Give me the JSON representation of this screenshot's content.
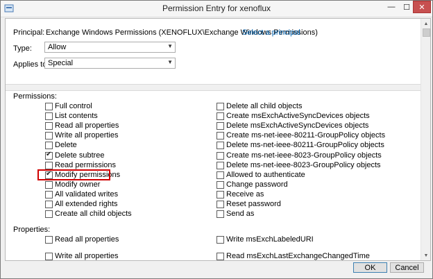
{
  "window": {
    "title": "Permission Entry for xenoflux"
  },
  "titlebar_buttons": {
    "minimize": "—",
    "maximize": "☐",
    "close": "✕"
  },
  "principal": {
    "label": "Principal:",
    "value": "Exchange Windows Permissions (XENOFLUX\\Exchange Windows Permissions)",
    "link": "Select a principal"
  },
  "type": {
    "label": "Type:",
    "value": "Allow"
  },
  "applies_to": {
    "label": "Applies to:",
    "value": "Special"
  },
  "permissions": {
    "heading": "Permissions:",
    "left": [
      {
        "label": "Full control",
        "checked": false
      },
      {
        "label": "List contents",
        "checked": false
      },
      {
        "label": "Read all properties",
        "checked": false
      },
      {
        "label": "Write all properties",
        "checked": false
      },
      {
        "label": "Delete",
        "checked": false
      },
      {
        "label": "Delete subtree",
        "checked": true
      },
      {
        "label": "Read permissions",
        "checked": false
      },
      {
        "label": "Modify permissions",
        "checked": true
      },
      {
        "label": "Modify owner",
        "checked": false
      },
      {
        "label": "All validated writes",
        "checked": false
      },
      {
        "label": "All extended rights",
        "checked": false
      },
      {
        "label": "Create all child objects",
        "checked": false
      }
    ],
    "right": [
      {
        "label": "Delete all child objects",
        "checked": false
      },
      {
        "label": "Create msExchActiveSyncDevices objects",
        "checked": false
      },
      {
        "label": "Delete msExchActiveSyncDevices objects",
        "checked": false
      },
      {
        "label": "Create ms-net-ieee-80211-GroupPolicy objects",
        "checked": false
      },
      {
        "label": "Delete ms-net-ieee-80211-GroupPolicy objects",
        "checked": false
      },
      {
        "label": "Create ms-net-ieee-8023-GroupPolicy objects",
        "checked": false
      },
      {
        "label": "Delete ms-net-ieee-8023-GroupPolicy objects",
        "checked": false
      },
      {
        "label": "Allowed to authenticate",
        "checked": false
      },
      {
        "label": "Change password",
        "checked": false
      },
      {
        "label": "Receive as",
        "checked": false
      },
      {
        "label": "Reset password",
        "checked": false
      },
      {
        "label": "Send as",
        "checked": false
      }
    ]
  },
  "properties": {
    "heading": "Properties:",
    "left": [
      {
        "label": "Read all properties",
        "checked": false
      },
      {
        "label": "Write all properties",
        "checked": false
      }
    ],
    "right": [
      {
        "label": "Write msExchLabeledURI",
        "checked": false
      },
      {
        "label": "Read msExchLastExchangeChangedTime",
        "checked": false
      }
    ]
  },
  "footer": {
    "ok": "OK",
    "cancel": "Cancel"
  },
  "colors": {
    "link": "#0063b1",
    "highlight": "#d00000",
    "close": "#c75050"
  }
}
